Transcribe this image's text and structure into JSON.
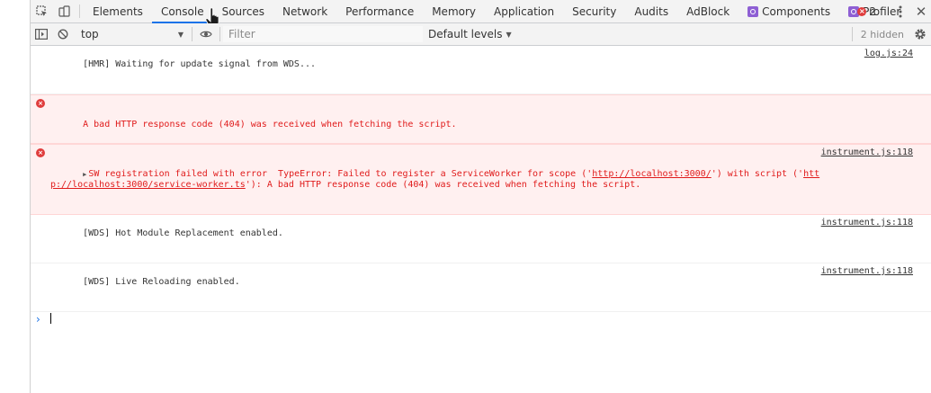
{
  "tabbar": {
    "tabs": [
      {
        "label": "Elements"
      },
      {
        "label": "Console",
        "active": true
      },
      {
        "label": "Sources"
      },
      {
        "label": "Network"
      },
      {
        "label": "Performance"
      },
      {
        "label": "Memory"
      },
      {
        "label": "Application"
      },
      {
        "label": "Security"
      },
      {
        "label": "Audits"
      },
      {
        "label": "AdBlock"
      },
      {
        "label": "Components",
        "icon": "react-icon"
      },
      {
        "label": "Profiler",
        "icon": "react-icon"
      }
    ],
    "error_count": "2"
  },
  "toolbar": {
    "context": "top",
    "filter_placeholder": "Filter",
    "levels_label": "Default levels",
    "hidden_label": "2 hidden"
  },
  "messages": [
    {
      "level": "info",
      "text": "[HMR] Waiting for update signal from WDS...",
      "source": "log.js:24"
    },
    {
      "level": "error",
      "text": "A bad HTTP response code (404) was received when fetching the script.",
      "source": ""
    },
    {
      "level": "error",
      "prefix": "SW registration failed with error  TypeError: Failed to register a ServiceWorker for scope ('",
      "link1": "http://localhost:3000/",
      "middle": "') with script ('",
      "link2": "http://localhost:3000/service-worker.ts",
      "suffix": "'): A bad HTTP response code (404) was received when fetching the script.",
      "source": "instrument.js:118"
    },
    {
      "level": "info",
      "text": "[WDS] Hot Module Replacement enabled.",
      "source": "instrument.js:118"
    },
    {
      "level": "info",
      "text": "[WDS] Live Reloading enabled.",
      "source": "instrument.js:118"
    }
  ],
  "colors": {
    "accent": "#1a73e8",
    "error": "#e01b1b",
    "error_bg": "#fff0f0"
  }
}
